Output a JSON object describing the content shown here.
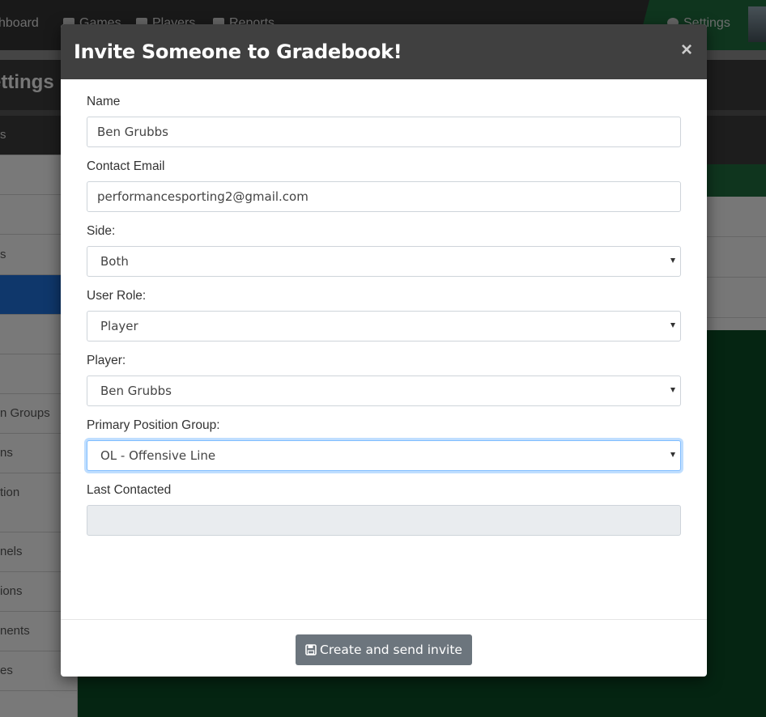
{
  "background": {
    "nav_items": [
      {
        "label": "shboard",
        "icon": "dashboard-icon"
      },
      {
        "label": "Games",
        "icon": "games-icon"
      },
      {
        "label": "Players",
        "icon": "players-icon"
      },
      {
        "label": "Reports",
        "icon": "reports-icon"
      }
    ],
    "settings_link": "Settings",
    "page_title": "ettings",
    "sidebar_items": [
      "s",
      "",
      "",
      "s",
      "",
      "",
      "",
      "n Groups",
      "ns",
      "tion",
      "nels",
      "ions",
      "nents",
      "es"
    ]
  },
  "modal": {
    "title": "Invite Someone to Gradebook!",
    "close_label": "×",
    "fields": {
      "name": {
        "label": "Name",
        "value": "Ben Grubbs"
      },
      "email": {
        "label": "Contact Email",
        "value": "performancesporting2@gmail.com"
      },
      "side": {
        "label": "Side:",
        "selected": "Both"
      },
      "role": {
        "label": "User Role:",
        "selected": "Player"
      },
      "player": {
        "label": "Player:",
        "selected": "Ben Grubbs"
      },
      "position": {
        "label": "Primary Position Group:",
        "selected": "OL - Offensive Line"
      },
      "last_contacted": {
        "label": "Last Contacted",
        "value": ""
      }
    },
    "submit_label": "Create and send invite"
  },
  "colors": {
    "header": "#404040",
    "button": "#6c757d",
    "focus": "#80bdff",
    "accent_green": "#1e6b3c",
    "accent_blue": "#1f6fd6"
  }
}
